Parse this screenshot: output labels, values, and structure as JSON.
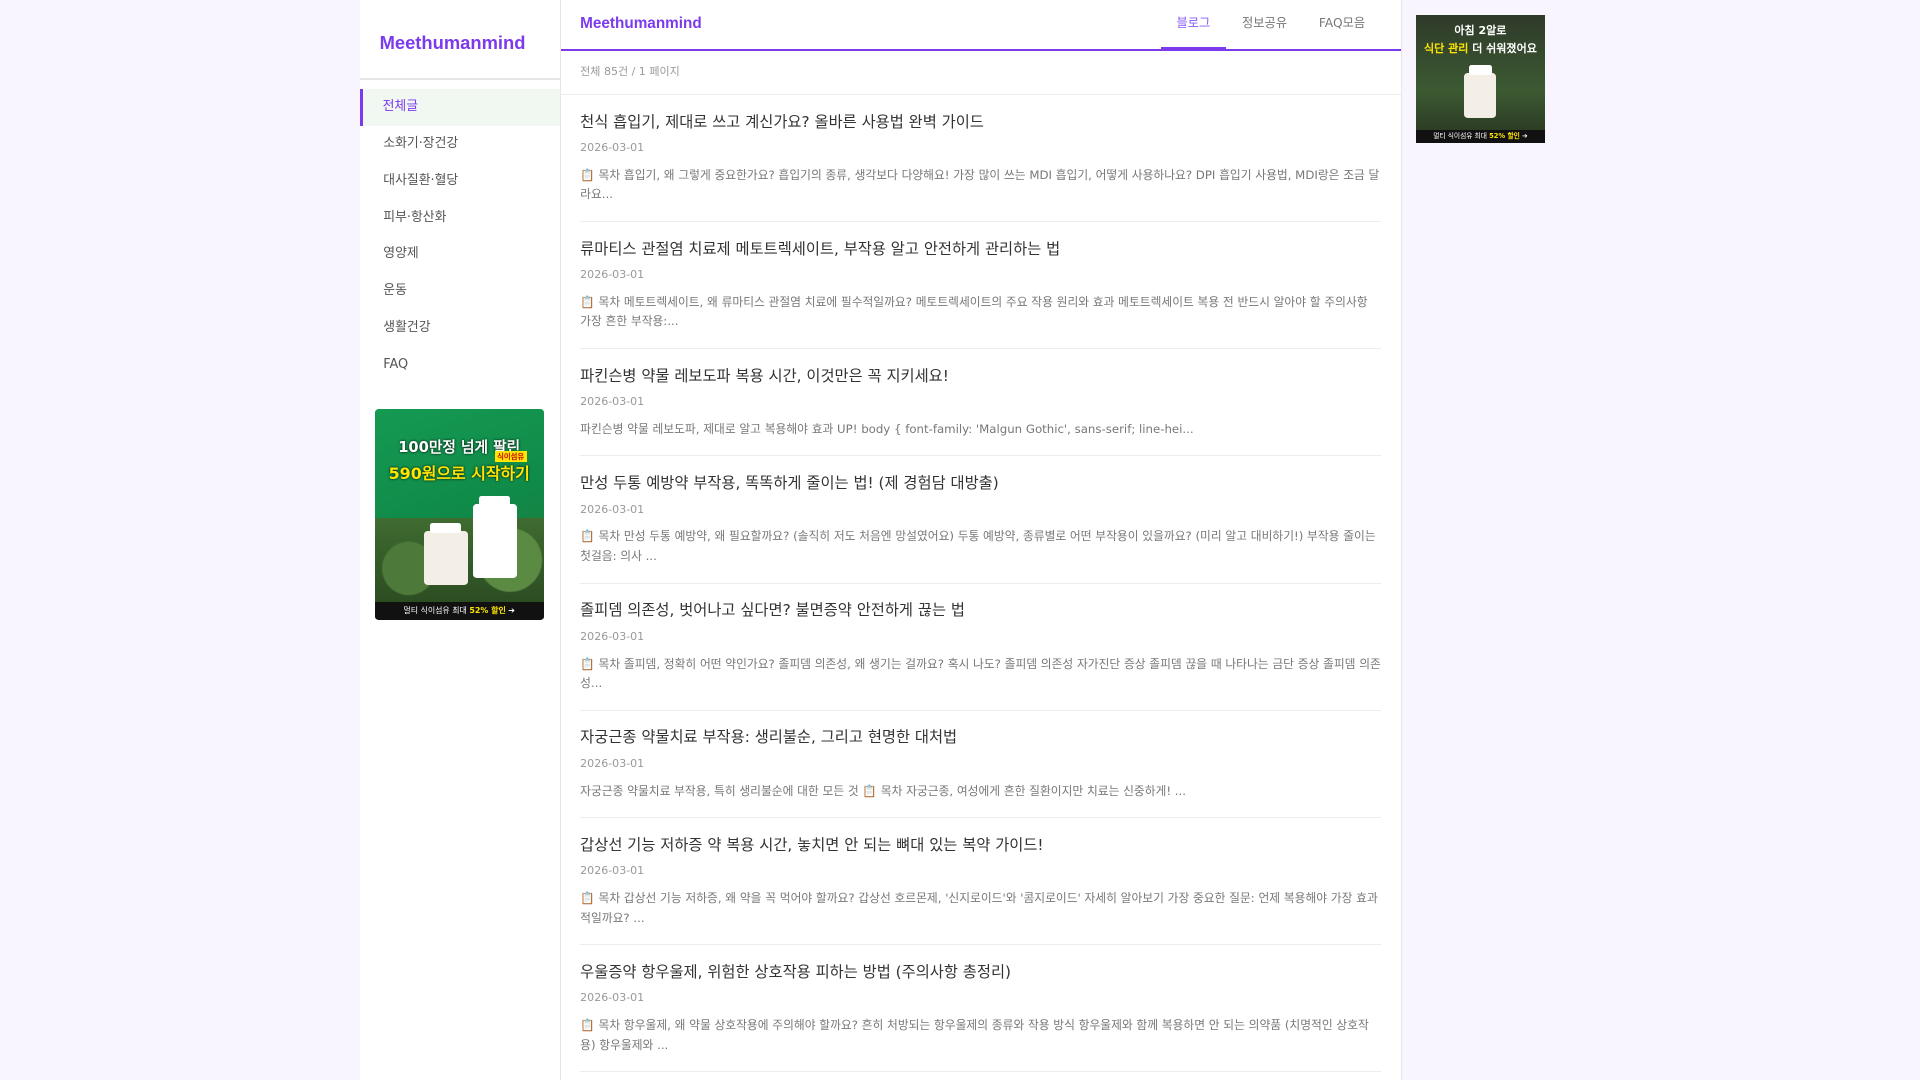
{
  "sidebar": {
    "brand": "Meethumanmind",
    "menu": [
      {
        "label": "전체글",
        "active": true
      },
      {
        "label": "소화기·장건강"
      },
      {
        "label": "대사질환·혈당"
      },
      {
        "label": "피부·항산화"
      },
      {
        "label": "영양제"
      },
      {
        "label": "운동"
      },
      {
        "label": "생활건강"
      },
      {
        "label": "FAQ"
      }
    ],
    "ad": {
      "line1": "100만정 넘게 팔린",
      "line2": "590원으로 시작하기",
      "badge": "식이섬유",
      "footer_prefix": "멀티 식이섬유 최대 ",
      "footer_highlight": "52% 할인"
    }
  },
  "header": {
    "brand": "Meethumanmind",
    "tabs": [
      {
        "label": "블로그",
        "active": true
      },
      {
        "label": "정보공유"
      },
      {
        "label": "FAQ모음"
      }
    ]
  },
  "main": {
    "count_text": "전체 85건 / 1 페이지",
    "posts": [
      {
        "title": "천식 흡입기, 제대로 쓰고 계신가요? 올바른 사용법 완벽 가이드",
        "date": "2026-03-01",
        "excerpt": "📋 목차 흡입기, 왜 그렇게 중요한가요? 흡입기의 종류, 생각보다 다양해요! 가장 많이 쓰는 MDI 흡입기, 어떻게 사용하나요? DPI 흡입기 사용법, MDI랑은 조금 달라요..."
      },
      {
        "title": "류마티스 관절염 치료제 메토트렉세이트, 부작용 알고 안전하게 관리하는 법",
        "date": "2026-03-01",
        "excerpt": "📋 목차 메토트렉세이트, 왜 류마티스 관절염 치료에 필수적일까요? 메토트렉세이트의 주요 작용 원리와 효과 메토트렉세이트 복용 전 반드시 알아야 할 주의사항 가장 흔한 부작용:..."
      },
      {
        "title": "파킨슨병 약물 레보도파 복용 시간, 이것만은 꼭 지키세요!",
        "date": "2026-03-01",
        "excerpt": "파킨슨병 약물 레보도파, 제대로 알고 복용해야 효과 UP! body { font-family: 'Malgun Gothic', sans-serif; line-hei..."
      },
      {
        "title": "만성 두통 예방약 부작용, 똑똑하게 줄이는 법! (제 경험담 대방출)",
        "date": "2026-03-01",
        "excerpt": "📋 목차 만성 두통 예방약, 왜 필요할까요? (솔직히 저도 처음엔 망설였어요) 두통 예방약, 종류별로 어떤 부작용이 있을까요? (미리 알고 대비하기!) 부작용 줄이는 첫걸음: 의사 ..."
      },
      {
        "title": "졸피뎀 의존성, 벗어나고 싶다면? 불면증약 안전하게 끊는 법",
        "date": "2026-03-01",
        "excerpt": "📋 목차 졸피뎀, 정확히 어떤 약인가요? 졸피뎀 의존성, 왜 생기는 걸까요? 혹시 나도? 졸피뎀 의존성 자가진단 증상 졸피뎀 끊을 때 나타나는 금단 증상 졸피뎀 의존성..."
      },
      {
        "title": "자궁근종 약물치료 부작용: 생리불순, 그리고 현명한 대처법",
        "date": "2026-03-01",
        "excerpt": "자궁근종 약물치료 부작용, 특히 생리불순에 대한 모든 것 📋 목차 자궁근종, 여성에게 흔한 질환이지만 치료는 신중하게! ..."
      },
      {
        "title": "갑상선 기능 저하증 약 복용 시간, 놓치면 안 되는 뼈대 있는 복약 가이드!",
        "date": "2026-03-01",
        "excerpt": "📋 목차 갑상선 기능 저하증, 왜 약을 꼭 먹어야 할까요? 갑상선 호르몬제, '신지로이드'와 '콤지로이드' 자세히 알아보기 가장 중요한 질문: 언제 복용해야 가장 효과적일까요? ..."
      },
      {
        "title": "우울증약 항우울제, 위험한 상호작용 피하는 방법 (주의사항 총정리)",
        "date": "2026-03-01",
        "excerpt": "📋 목차 항우울제, 왜 약물 상호작용에 주의해야 할까요? 흔히 처방되는 항우울제의 종류와 작용 방식 항우울제와 함께 복용하면 안 되는 의약품 (치명적인 상호작용) 항우울제와 ..."
      }
    ]
  },
  "right_ad": {
    "line1": "아침 2알로",
    "line2_highlight": "식단 관리",
    "line2_rest": " 더 쉬워졌어요",
    "footer_prefix": "멀티 식이섬유 최대 ",
    "footer_highlight": "52% 할인"
  },
  "colors": {
    "accent": "#7c3aed",
    "page_bg": "#f9f5fe",
    "active_item_bg": "#f1f7f1"
  }
}
